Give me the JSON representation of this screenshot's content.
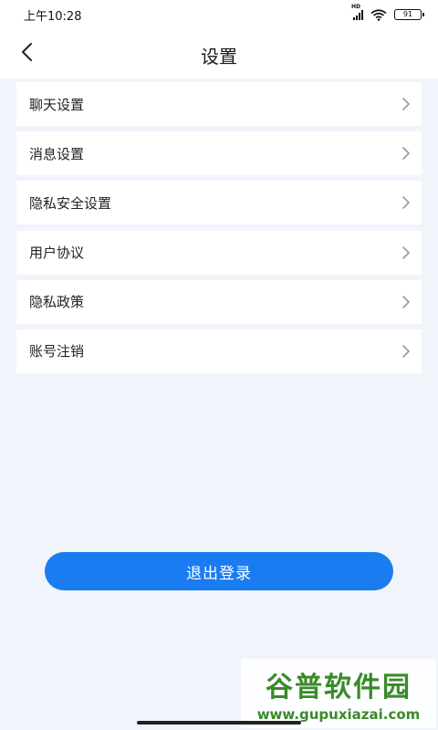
{
  "status_bar": {
    "time": "上午10:28",
    "hd_label": "HD",
    "battery": "91",
    "icons": [
      "signal-icon",
      "wifi-icon",
      "battery-icon"
    ]
  },
  "header": {
    "title": "设置",
    "back_icon": "chevron-left-icon"
  },
  "menu": {
    "items": [
      {
        "label": "聊天设置"
      },
      {
        "label": "消息设置"
      },
      {
        "label": "隐私安全设置"
      },
      {
        "label": "用户协议"
      },
      {
        "label": "隐私政策"
      },
      {
        "label": "账号注销"
      }
    ],
    "chevron_icon": "chevron-right-icon"
  },
  "logout": {
    "label": "退出登录",
    "color": "#1a7cf1"
  },
  "watermark": {
    "title": "谷普软件园",
    "url": "www.gupuxiazai.com",
    "color": "#3a8a2a"
  }
}
